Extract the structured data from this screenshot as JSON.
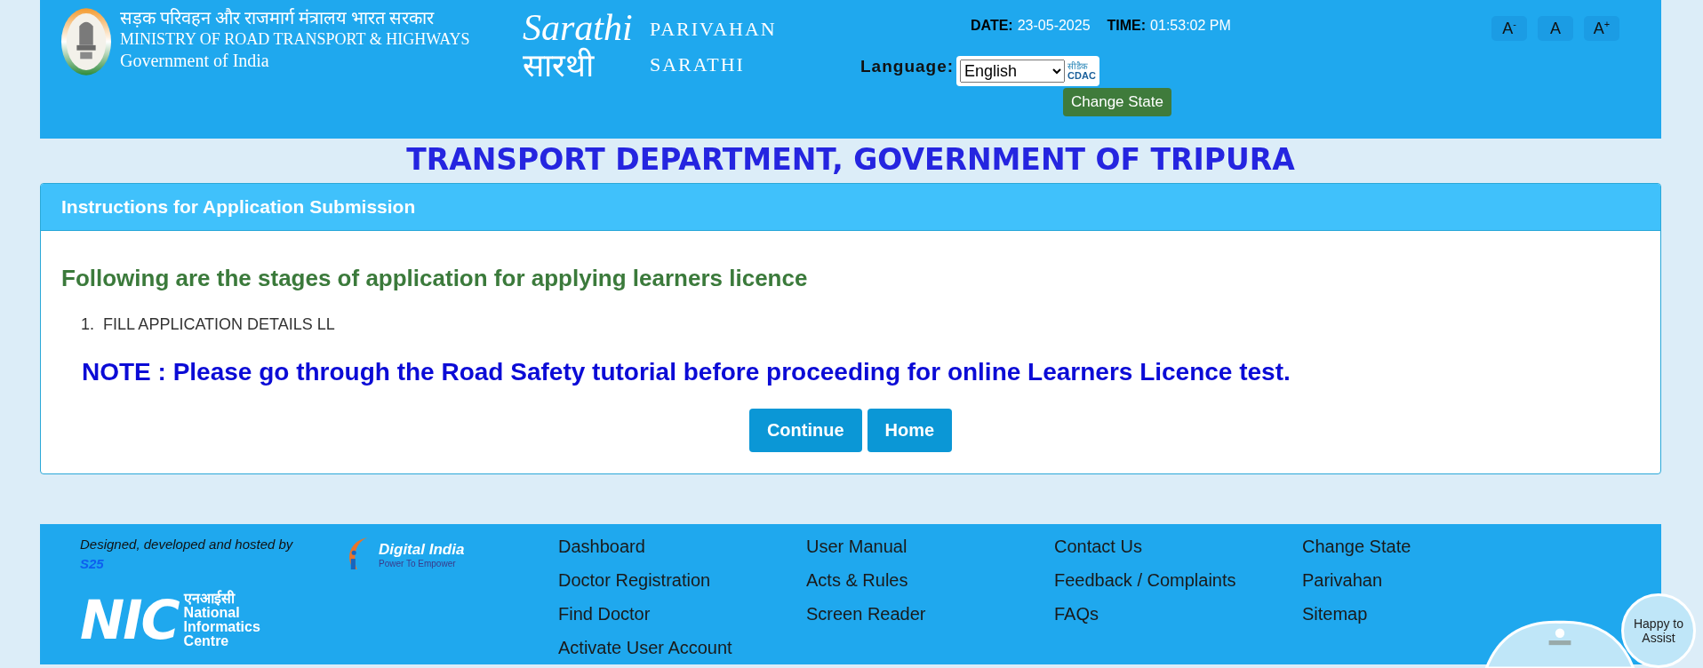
{
  "header": {
    "ministry_lines": [
      "सड़क परिवहन और राजमार्ग मंत्रालय भारत सरकार",
      "MINISTRY OF ROAD TRANSPORT & HIGHWAYS",
      "Government of India"
    ],
    "sarathi_logo": {
      "latin": "Sarathi",
      "hindi": "सारथी"
    },
    "portal_name": [
      "PARIVAHAN",
      "SARATHI"
    ],
    "date_label": "DATE:",
    "date": "23-05-2025",
    "time_label": "TIME:",
    "time": "01:53:02 PM",
    "font_size_buttons": [
      "A$^{-}$",
      "A",
      "A$^{+}$"
    ],
    "language_label": "Language:",
    "language": "English",
    "cdac_logo": {
      "hindi": "सीडैक",
      "latin": "CDAC"
    },
    "change_state_button": "Change State"
  },
  "page_title": "TRANSPORT DEPARTMENT, GOVERNMENT OF TRIPURA",
  "panel": {
    "heading": "Instructions for Application Submission",
    "subheading": "Following are the stages of application for applying learners licence",
    "steps": [
      {
        "number": "1.",
        "text": "FILL APPLICATION DETAILS LL"
      }
    ],
    "note": "NOTE : Please go through the Road Safety tutorial before proceeding for online Learners Licence test.",
    "buttons": [
      "Continue",
      "Home"
    ]
  },
  "footer": {
    "credit": "Designed, developed and hosted by",
    "credit_link": "S25",
    "digital_india_logo": {
      "title": "Digital India",
      "tagline": "Power To Empower"
    },
    "nic_logo": {
      "mark": "NIC",
      "hindi": "एनआईसी",
      "name_lines": [
        "National",
        "Informatics",
        "Centre"
      ]
    },
    "link_columns": [
      [
        "Dashboard",
        "Doctor Registration",
        "Find Doctor",
        "Activate User Account"
      ],
      [
        "User Manual",
        "Acts & Rules",
        "Screen Reader"
      ],
      [
        "Contact Us",
        "Feedback / Complaints",
        "FAQs"
      ],
      [
        "Change State",
        "Parivahan",
        "Sitemap"
      ]
    ]
  },
  "assistant": {
    "label": "Happy to Assist"
  }
}
